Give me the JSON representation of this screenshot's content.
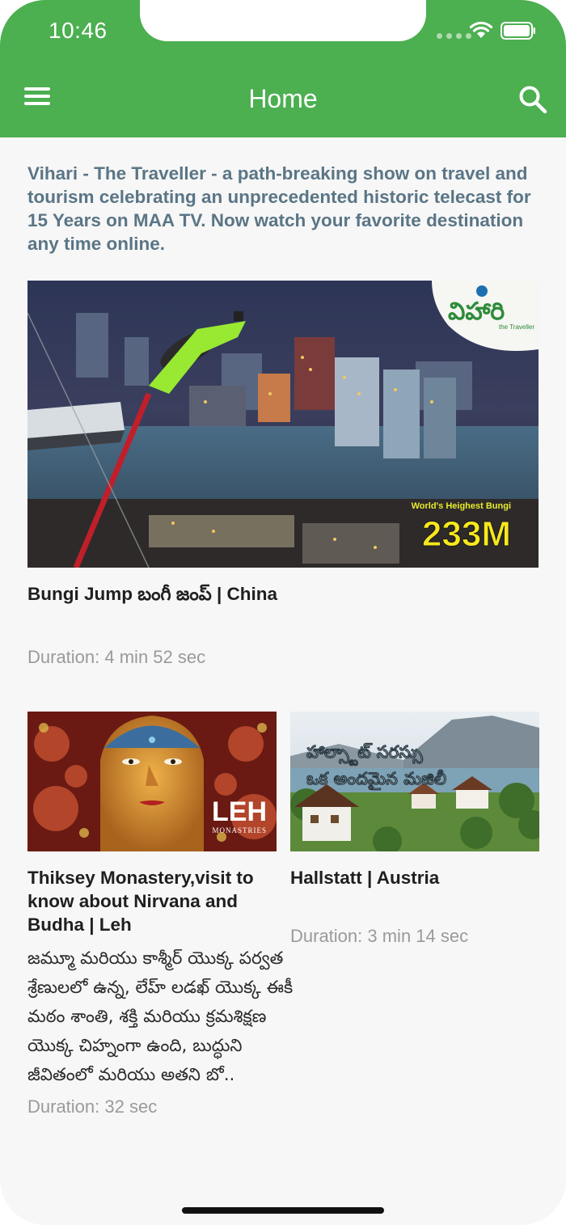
{
  "status_bar": {
    "time": "10:46"
  },
  "header": {
    "title": "Home",
    "menu_icon": "hamburger-menu-icon",
    "search_icon": "search-icon",
    "bg_color": "#4caf50"
  },
  "intro": "Vihari - The Traveller - a path-breaking show on travel and tourism celebrating an unprecedented historic telecast for 15 Years on MAA TV. Now watch your favorite destination any time online.",
  "featured": {
    "title": "Bungi Jump బంగీ జంప్  | China",
    "duration": "Duration: 4 min 52 sec",
    "thumb_logo": "విహారి",
    "thumb_logo_sub": "the Traveller",
    "thumb_caption": "World's Heighest Bungi",
    "thumb_big": "233M"
  },
  "videos": [
    {
      "title": "Thiksey Monastery,visit to know about Nirvana and Budha | Leh",
      "description": "జమ్మూ మరియు కాశ్మీర్ యొక్క పర్వత శ్రేణులలో ఉన్న, లేహ్ లడఖ్ యొక్క ఈకీ మఠం శాంతి, శక్తి మరియు క్రమశిక్షణ యొక్క చిహ్నంగా ఉంది, బుద్ధుని జీవితంలో మరియు అతని బో..",
      "duration": "Duration: 32 sec",
      "thumb_text": "LEH",
      "thumb_sub": "MONASTRIES"
    },
    {
      "title": "Hallstatt  | Austria",
      "description": "",
      "duration": "Duration: 3 min 14 sec",
      "thumb_line1": "హాల్స్టాట్ సరస్సు",
      "thumb_line2": "ఒక అందమైన మజిలీ"
    }
  ]
}
